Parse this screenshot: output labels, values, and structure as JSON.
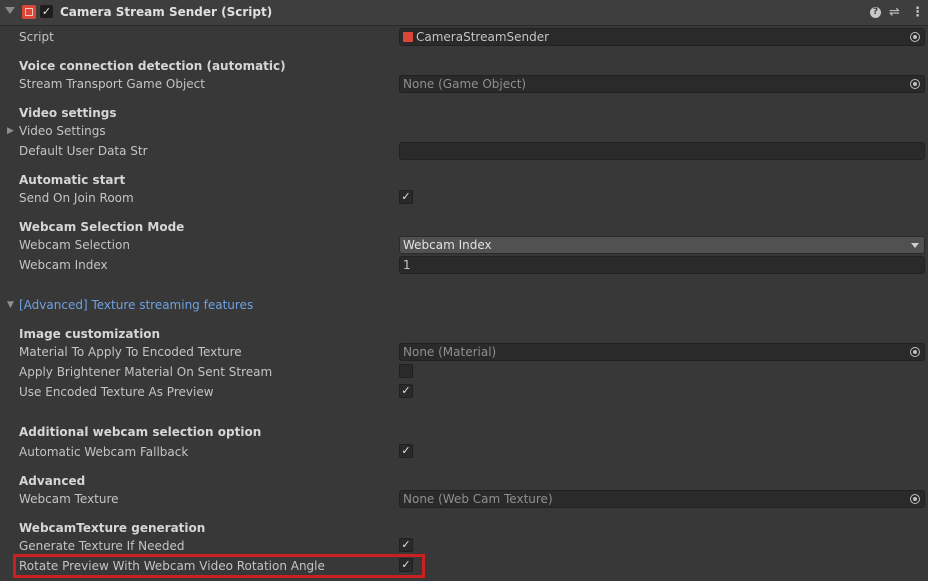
{
  "header": {
    "title": "Camera Stream Sender (Script)",
    "help_glyph": "?",
    "presets_glyph": "⇌",
    "menu_glyph": "⋮"
  },
  "script": {
    "label": "Script",
    "value": "CameraStreamSender"
  },
  "voice": {
    "heading": "Voice connection detection (automatic)",
    "transport_label": "Stream Transport Game Object",
    "transport_value": "None (Game Object)"
  },
  "video": {
    "heading": "Video settings",
    "foldout_label": "Video Settings",
    "user_data_label": "Default User Data Str",
    "user_data_value": ""
  },
  "autostart": {
    "heading": "Automatic start",
    "send_on_join_label": "Send On Join Room",
    "send_on_join_checked": true
  },
  "webcam_mode": {
    "heading": "Webcam Selection Mode",
    "selection_label": "Webcam Selection",
    "selection_value": "Webcam Index",
    "index_label": "Webcam Index",
    "index_value": "1"
  },
  "advanced_foldout": {
    "label": "[Advanced] Texture streaming features"
  },
  "image_custom": {
    "heading": "Image customization",
    "material_label": "Material To Apply To Encoded Texture",
    "material_value": "None (Material)",
    "brightener_label": "Apply Brightener Material On Sent Stream",
    "brightener_checked": false,
    "encoded_preview_label": "Use Encoded Texture As Preview",
    "encoded_preview_checked": true
  },
  "additional": {
    "heading": "Additional webcam selection option",
    "fallback_label": "Automatic Webcam Fallback",
    "fallback_checked": true
  },
  "advanced": {
    "heading": "Advanced",
    "webcam_texture_label": "Webcam Texture",
    "webcam_texture_value": "None (Web Cam Texture)"
  },
  "texgen": {
    "heading": "WebcamTexture generation",
    "generate_label": "Generate Texture If Needed",
    "generate_checked": true,
    "rotate_label": "Rotate Preview With Webcam Video Rotation Angle",
    "rotate_checked": true
  },
  "colors": {
    "accent_link": "#6ea1e0",
    "highlight_border": "#cc1f1f",
    "script_icon": "#d9463a"
  }
}
